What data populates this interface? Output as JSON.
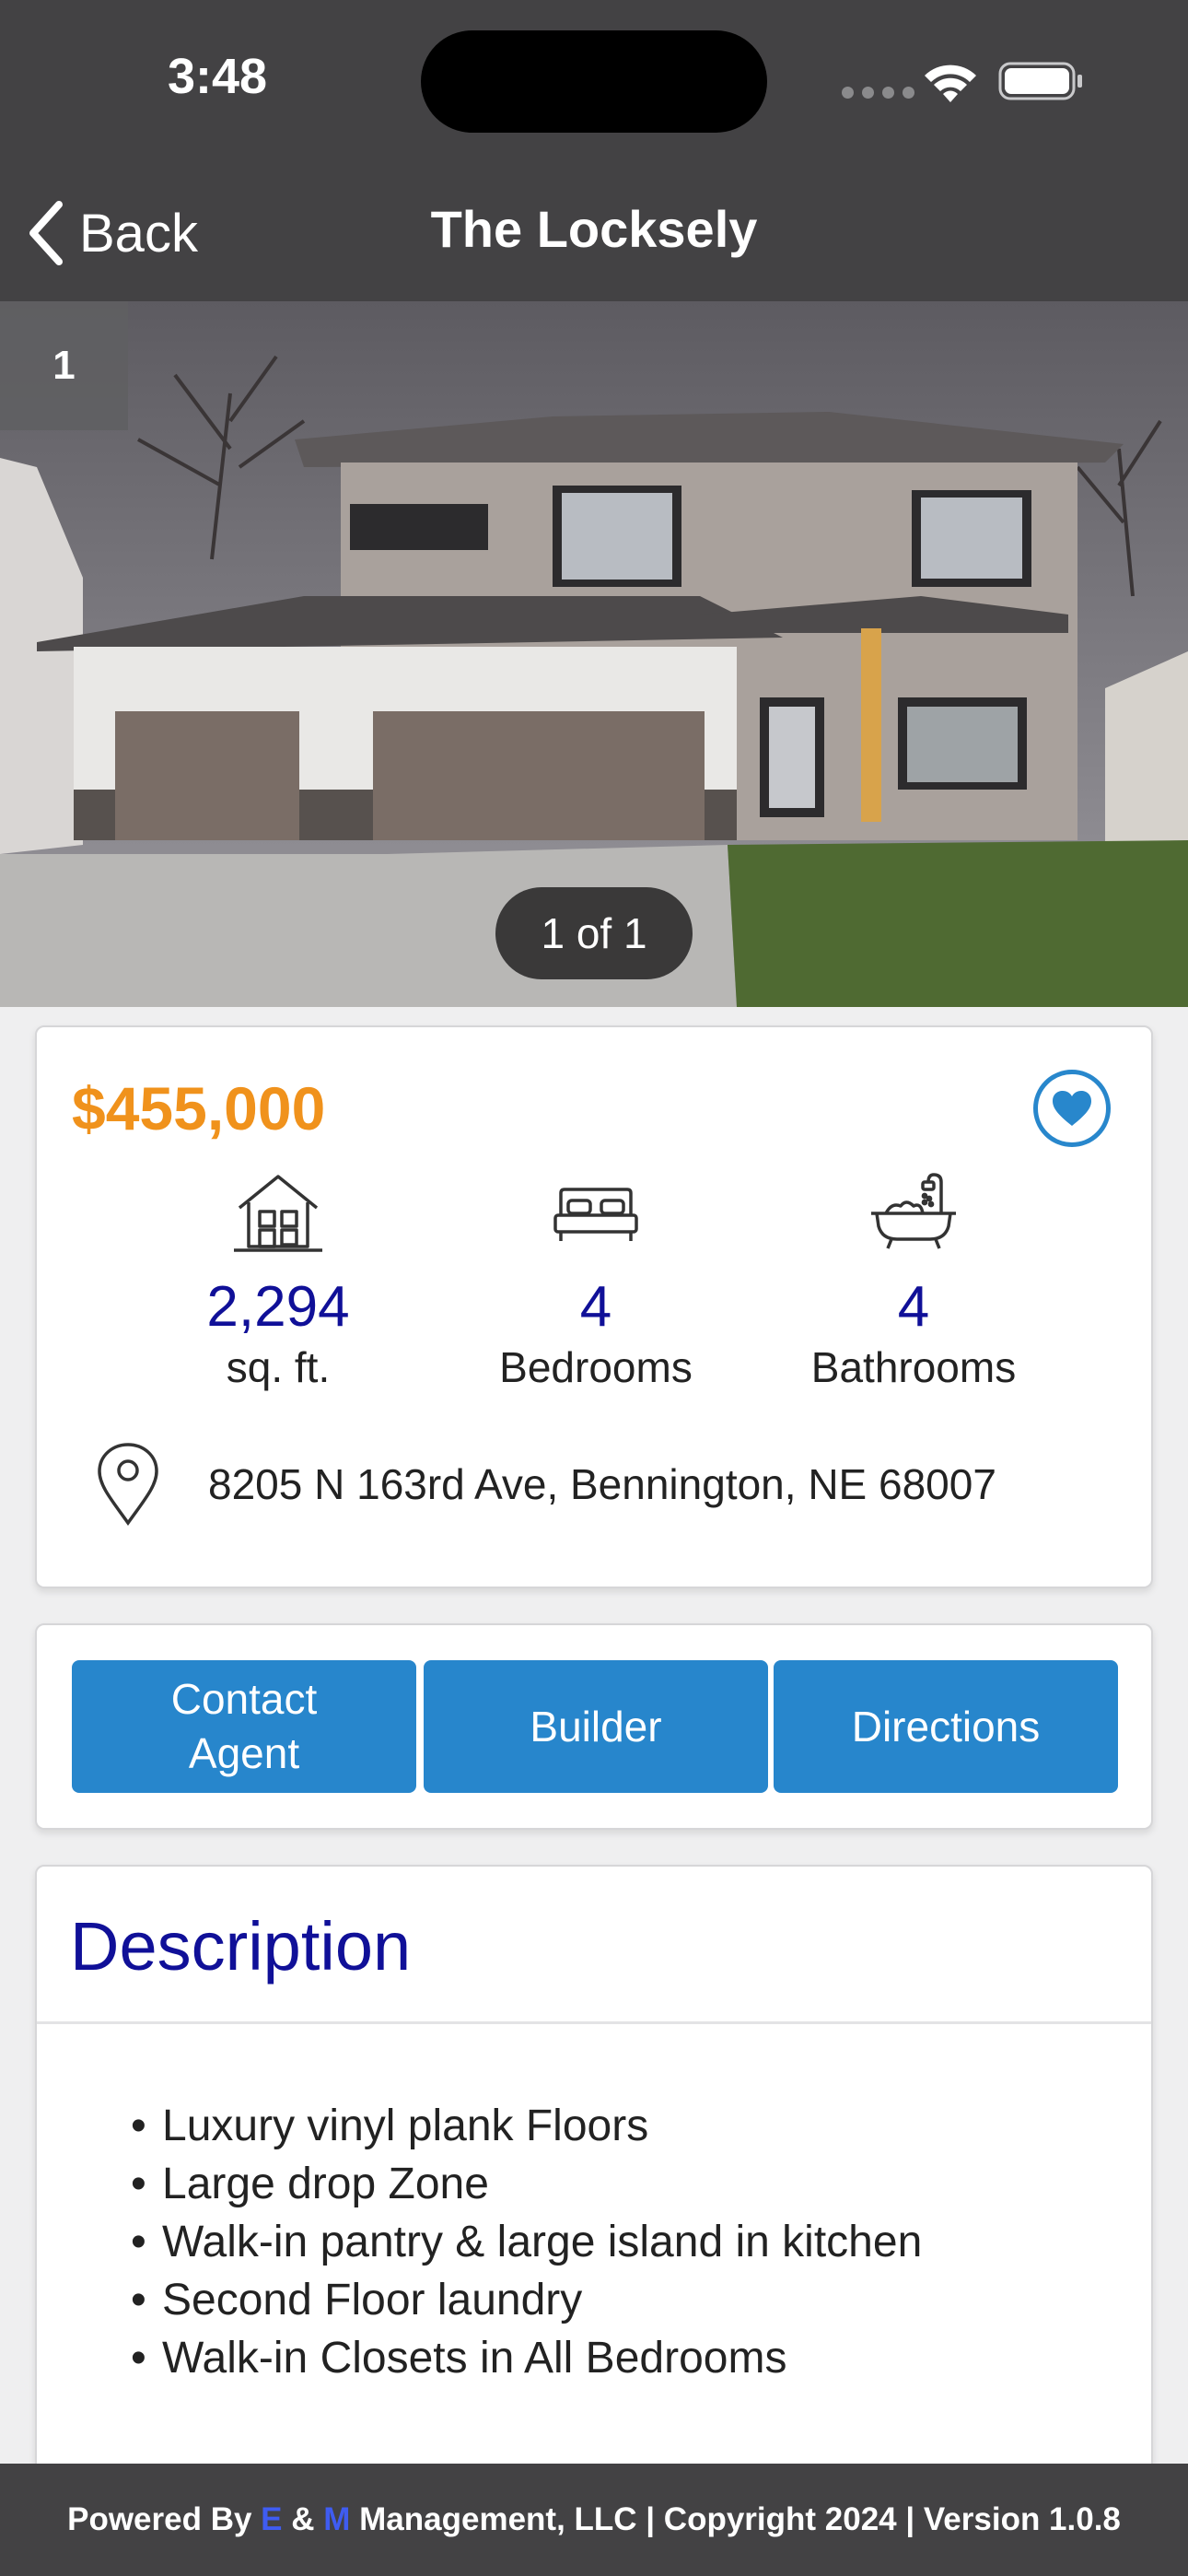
{
  "status_bar": {
    "time": "3:48"
  },
  "nav": {
    "back_label": "Back",
    "title": "The Locksely"
  },
  "photo": {
    "index_badge": "1",
    "counter": "1 of 1"
  },
  "listing": {
    "price": "$455,000",
    "price_color": "#f0921c",
    "favorite_icon": "heart-icon",
    "stats": [
      {
        "icon": "house-icon",
        "value": "2,294",
        "label": "sq. ft."
      },
      {
        "icon": "bed-icon",
        "value": "4",
        "label": "Bedrooms"
      },
      {
        "icon": "bathtub-icon",
        "value": "4",
        "label": "Bathrooms"
      }
    ],
    "address": "8205 N 163rd Ave, Bennington, NE 68007"
  },
  "actions": {
    "contact_label_line1": "Contact",
    "contact_label_line2": "Agent",
    "builder_label": "Builder",
    "directions_label": "Directions",
    "button_color": "#2786cc"
  },
  "description": {
    "title": "Description",
    "items": [
      "Luxury vinyl plank Floors",
      "Large drop Zone",
      "Walk-in pantry & large island in kitchen",
      "Second Floor laundry",
      "Walk-in Closets in All Bedrooms"
    ]
  },
  "footer": {
    "prefix": "Powered By ",
    "letter_e": "E",
    "ampersand": " & ",
    "letter_m": "M",
    "suffix": " Management, LLC | Copyright 2024 | Version 1.0.8"
  }
}
